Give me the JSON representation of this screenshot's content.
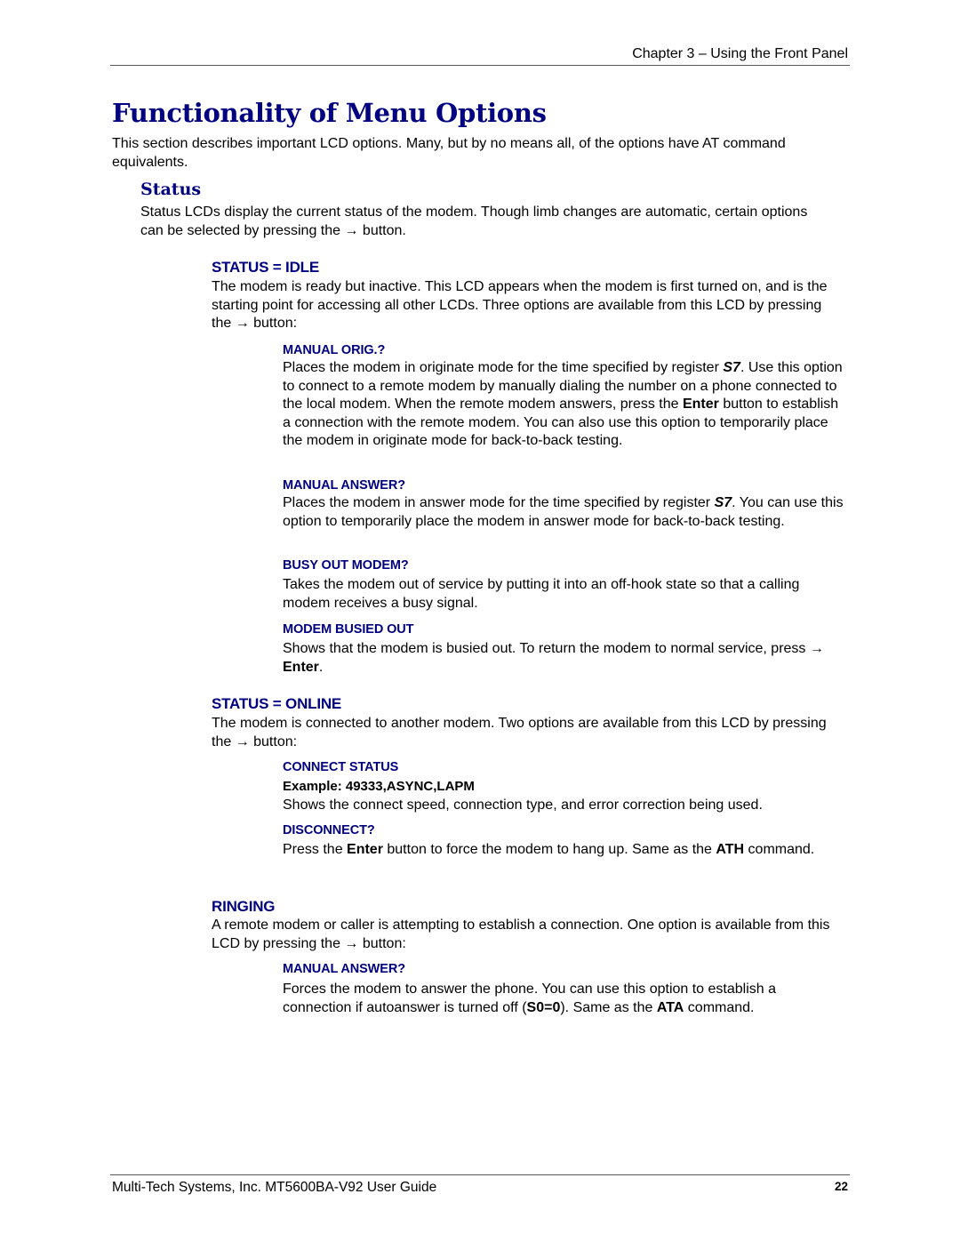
{
  "header": {
    "chapter": "Chapter 3 – Using the Front Panel"
  },
  "title": "Functionality of Menu Options",
  "intro": "This section describes important LCD options. Many, but by no means all, of the options have AT command equivalents.",
  "status_section": {
    "heading": "Status",
    "text_before_arrow": "Status LCDs display the current status of the modem. Though limb changes are automatic, certain options can be selected by pressing the ",
    "arrow": "→",
    "text_after_arrow": " button."
  },
  "idle": {
    "heading": "STATUS = IDLE",
    "text_before_arrow": "The modem is ready but inactive. This LCD appears when the modem is first turned on, and is the starting point for accessing all other LCDs. Three options are available from this LCD by pressing the ",
    "arrow": "→",
    "text_after_arrow": " button:",
    "manual_orig": {
      "heading": "MANUAL ORIG.?",
      "t1": "Places the modem in originate mode for the time specified by register ",
      "reg": "S7",
      "t2": ". Use this option to connect to a remote modem by manually dialing the number on a phone connected to the local modem. When the remote modem answers, press the ",
      "enter": "Enter",
      "t3": " button to establish a connection with the remote modem. You can also use this option to temporarily place the modem in originate mode for back-to-back testing."
    },
    "manual_answer": {
      "heading": "MANUAL ANSWER?",
      "t1": "Places the modem in answer mode for the time specified by register ",
      "reg": "S7",
      "t2": ". You can use this option to temporarily place the modem in answer mode for back-to-back testing."
    },
    "busy_out": {
      "heading": "BUSY OUT MODEM?",
      "text": "Takes the modem out of service by putting it into an off-hook state so that a calling modem receives a busy signal."
    },
    "busied_out": {
      "heading": "MODEM BUSIED OUT",
      "t1": "Shows that the modem is busied out. To return the modem to normal service, press ",
      "arrow": "→",
      "enter": "Enter",
      "t2": "."
    }
  },
  "online": {
    "heading": "STATUS = ONLINE",
    "text_before_arrow": "The modem is connected to another modem. Two options are available from this LCD by pressing the ",
    "arrow": "→",
    "text_after_arrow": " button:",
    "connect_status": {
      "heading": "CONNECT STATUS",
      "example": "Example: 49333,ASYNC,LAPM",
      "text": "Shows the connect speed, connection type, and error correction being used."
    },
    "disconnect": {
      "heading": "DISCONNECT?",
      "t1": "Press the ",
      "enter": "Enter",
      "t2": " button to force the modem to hang up. Same as the ",
      "cmd": "ATH",
      "t3": " command."
    }
  },
  "ringing": {
    "heading": "RINGING",
    "text_before_arrow": "A remote modem or caller is attempting to establish a connection. One option is available from this LCD by pressing the ",
    "arrow": "→",
    "text_after_arrow": " button:",
    "manual_answer": {
      "heading": "MANUAL ANSWER?",
      "t1": "Forces the modem to answer the phone. You can use this option to establish a connection if autoanswer is turned off (",
      "reg": "S0=0",
      "t2": "). Same as the ",
      "cmd": "ATA",
      "t3": " command."
    }
  },
  "footer": {
    "guide": "Multi-Tech Systems, Inc. MT5600BA-V92 User Guide",
    "page": "22"
  }
}
